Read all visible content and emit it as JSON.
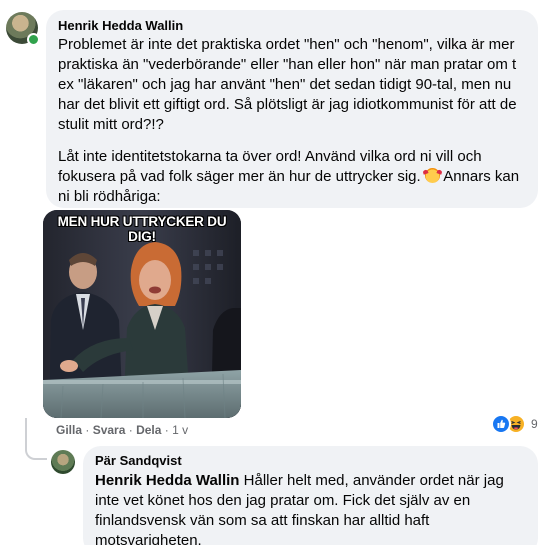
{
  "comment1": {
    "author": "Henrik Hedda Wallin",
    "paragraph1": "Problemet är inte det praktiska ordet \"hen\" och \"henom\", vilka är mer praktiska än \"vederbörande\" eller \"han eller hon\" när man pratar om t ex \"läkaren\" och jag har använt \"hen\" det sedan tidigt 90-tal, men nu har det blivit ett giftigt ord. Så plötsligt är jag idiotkommunist för att de stulit mitt ord?!?",
    "paragraph2": "Låt inte identitetstokarna ta över ord! Använd vilka ord ni vill och fokusera på vad folk säger mer än hur de uttrycker sig.",
    "paragraph2_tail": " Annars kan ni bli rödhåriga:",
    "emoji": "smiling-face-with-hearts-icon",
    "gif_caption": "MEN HUR UTTRYCKER DU DIG!",
    "actions": {
      "like": "Gilla",
      "reply": "Svara",
      "share": "Dela",
      "separator": " · ",
      "time": "1 v"
    },
    "reactions": {
      "types": [
        "like-icon",
        "haha-icon"
      ],
      "count": "9"
    }
  },
  "comment2": {
    "author": "Pär Sandqvist",
    "mention": "Henrik Hedda Wallin",
    "text": " Håller helt med, använder ordet när jag inte vet könet hos den jag pratar om. Fick det själv av en finlandsvensk vän som sa att finskan har alltid haft motsvarigheten."
  },
  "colors": {
    "bubble": "#f0f2f5",
    "meta_text": "#65676b",
    "like_blue": "#1877f2",
    "online_green": "#31a24c"
  }
}
